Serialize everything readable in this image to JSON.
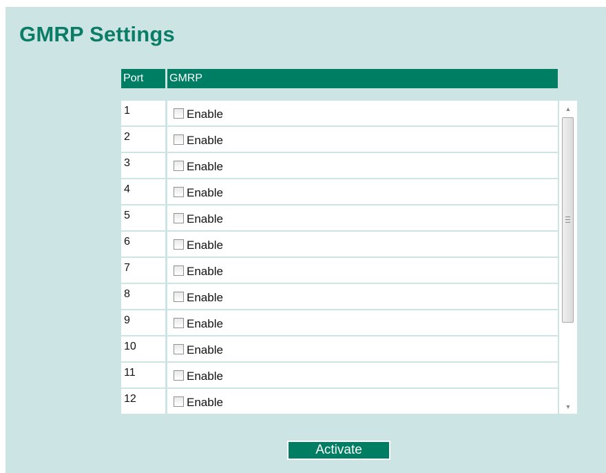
{
  "page": {
    "title": "GMRP Settings"
  },
  "table": {
    "headers": {
      "port": "Port",
      "gmrp": "GMRP"
    },
    "checkbox_label": "Enable",
    "rows": [
      {
        "port": "1",
        "label": "Enable",
        "checked": false
      },
      {
        "port": "2",
        "label": "Enable",
        "checked": false
      },
      {
        "port": "3",
        "label": "Enable",
        "checked": false
      },
      {
        "port": "4",
        "label": "Enable",
        "checked": false
      },
      {
        "port": "5",
        "label": "Enable",
        "checked": false
      },
      {
        "port": "6",
        "label": "Enable",
        "checked": false
      },
      {
        "port": "7",
        "label": "Enable",
        "checked": false
      },
      {
        "port": "8",
        "label": "Enable",
        "checked": false
      },
      {
        "port": "9",
        "label": "Enable",
        "checked": false
      },
      {
        "port": "10",
        "label": "Enable",
        "checked": false
      },
      {
        "port": "11",
        "label": "Enable",
        "checked": false
      },
      {
        "port": "12",
        "label": "Enable",
        "checked": false
      }
    ]
  },
  "scrollbar": {
    "up_icon": "scroll-up-arrow-icon",
    "down_icon": "scroll-down-arrow-icon"
  },
  "actions": {
    "activate_label": "Activate"
  },
  "colors": {
    "background": "#cde4e4",
    "accent": "#007e63",
    "title": "#0b7c66"
  }
}
